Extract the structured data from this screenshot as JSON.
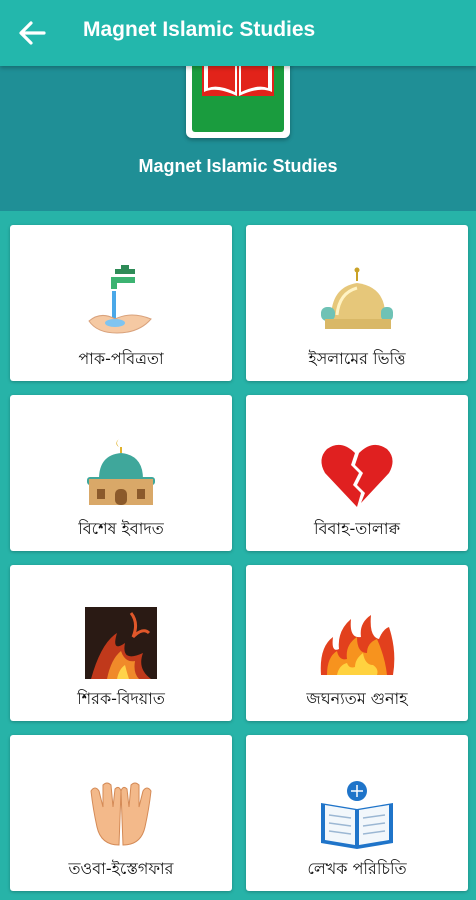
{
  "appbar": {
    "title": "Magnet Islamic Studies"
  },
  "hero": {
    "title": "Magnet Islamic Studies"
  },
  "cards": [
    {
      "label": "পাক-পবিত্রতা",
      "icon": "water-tap-hands-icon"
    },
    {
      "label": "ইসলামের ভিত্তি",
      "icon": "mosque-dome-icon"
    },
    {
      "label": "বিশেষ ইবাদত",
      "icon": "mosque-icon"
    },
    {
      "label": "বিবাহ-তালাক্ব",
      "icon": "broken-heart-icon"
    },
    {
      "label": "শিরক-বিদয়াত",
      "icon": "lava-icon"
    },
    {
      "label": "জঘন্যতম গুনাহ",
      "icon": "fire-icon"
    },
    {
      "label": "তওবা-ইস্তেগফার",
      "icon": "praying-hands-icon"
    },
    {
      "label": "লেখক পরিচিতি",
      "icon": "book-icon"
    }
  ],
  "colors": {
    "appbar": "#23b7ac",
    "hero": "#1f8f96",
    "background": "#27b3a8"
  }
}
